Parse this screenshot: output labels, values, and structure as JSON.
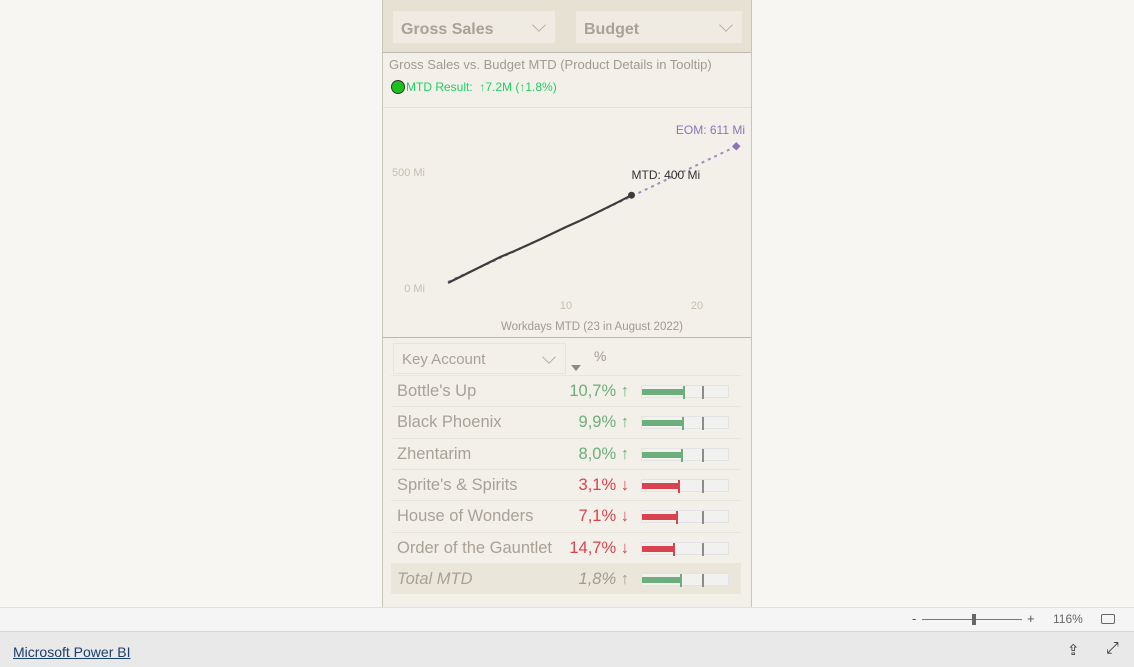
{
  "slicers": {
    "measure": "Gross Sales",
    "comparison": "Budget"
  },
  "visual": {
    "title": "Gross Sales vs. Budget MTD (Product Details in Tooltip)",
    "result_label": "MTD Result:",
    "result_value": "↑7.2M (↑1.8%)",
    "result_color": "#1cc21c"
  },
  "chart_data": {
    "type": "line",
    "xlabel": "Workdays MTD (23 in August 2022)",
    "x_ticks": [
      "10",
      "20"
    ],
    "y_ticks": [
      "0 Mi",
      "500 Mi"
    ],
    "xlim": [
      0,
      24
    ],
    "ylim": [
      0,
      700
    ],
    "series": [
      {
        "style": "solid",
        "color": "#3c3c3c",
        "x": [
          1,
          2,
          3,
          4,
          5,
          6,
          7,
          8,
          9,
          10,
          11,
          12,
          13,
          14,
          15
        ],
        "values": [
          22,
          50,
          78,
          106,
          134,
          158,
          183,
          209,
          236,
          263,
          288,
          315,
          343,
          371,
          400
        ]
      },
      {
        "style": "dotted",
        "color": "#a08cc0",
        "x": [
          1,
          5,
          10,
          15,
          23
        ],
        "values": [
          27,
          130,
          262,
          395,
          611
        ]
      }
    ],
    "annotations": {
      "mtd": "MTD: 400 Mi",
      "eom": "EOM: 611 Mi"
    }
  },
  "table": {
    "header": {
      "column": "Key Account",
      "pct": "%"
    },
    "rows": [
      {
        "name": "Bottle's Up",
        "value": "10,7% ↑",
        "dir": "up",
        "fill": 0.49
      },
      {
        "name": "Black Phoenix",
        "value": "9,9% ↑",
        "dir": "up",
        "fill": 0.48
      },
      {
        "name": "Zhentarim",
        "value": "8,0% ↑",
        "dir": "up",
        "fill": 0.47
      },
      {
        "name": "Sprite's & Spirits",
        "value": "3,1% ↓",
        "dir": "down",
        "fill": 0.43
      },
      {
        "name": "House of Wonders",
        "value": "7,1% ↓",
        "dir": "down",
        "fill": 0.41
      },
      {
        "name": "Order of the Gauntlet",
        "value": "14,7% ↓",
        "dir": "down",
        "fill": 0.37
      }
    ],
    "total": {
      "name": "Total MTD",
      "value": "1,8% ↑",
      "dir": "up",
      "fill": 0.45
    },
    "target": 0.68,
    "colors": {
      "up": "#6dae7c",
      "down": "#d9434f"
    }
  },
  "zoom": {
    "minus": "-",
    "plus": "+",
    "level": "116%",
    "level_fraction": 0.5
  },
  "footer": {
    "brand": "Microsoft Power BI"
  }
}
